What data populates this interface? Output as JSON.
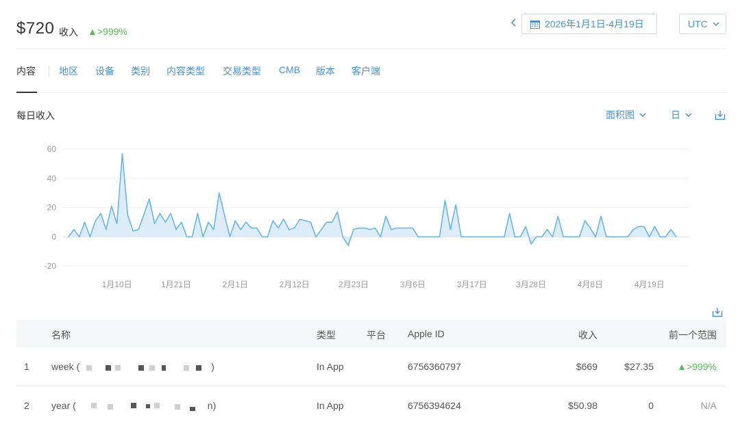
{
  "header": {
    "total": "$720",
    "total_label": "收入",
    "total_change": "▲>999%",
    "date_range": "2026年1月1日-4月19日",
    "timezone": "UTC"
  },
  "tabs": [
    "内容",
    "地区",
    "设备",
    "类别",
    "内容类型",
    "交易类型",
    "CMB",
    "版本",
    "客户端"
  ],
  "section": {
    "title": "每日收入",
    "chart_type_label": "面积图",
    "interval_label": "日"
  },
  "colors": {
    "accent": "#4a90d0",
    "area_fill": "#d6eaf8",
    "area_line": "#6ab4e6",
    "positive": "#5cb85c"
  },
  "icons": [
    "calendar-icon",
    "chevron-left-icon",
    "chevron-down-icon",
    "download-icon"
  ],
  "chart_data": {
    "type": "area",
    "title": "每日收入",
    "x_start": "2026-01-01",
    "y_ticks": [
      60,
      40,
      20,
      0,
      -20
    ],
    "x_ticks": [
      "1月10日",
      "1月21日",
      "2月1日",
      "2月12日",
      "2月23日",
      "3月6日",
      "3月17日",
      "3月28日",
      "4月8日",
      "4月19日"
    ],
    "ylim": [
      -20,
      60
    ],
    "grid": true,
    "series": [
      {
        "values": [
          0,
          5,
          0,
          10,
          0,
          11,
          16,
          5,
          21,
          9,
          57,
          15,
          4,
          5,
          15,
          26,
          9,
          16,
          10,
          16,
          5,
          10,
          0,
          0,
          16,
          0,
          10,
          5,
          30,
          15,
          0,
          11,
          5,
          10,
          6,
          6,
          0,
          0,
          11,
          6,
          12,
          5,
          6,
          12,
          11,
          10,
          0,
          5,
          10,
          10,
          17,
          0,
          -6,
          5,
          6,
          6,
          5,
          6,
          0,
          14,
          5,
          6,
          6,
          6,
          6,
          0,
          0,
          0,
          0,
          0,
          25,
          5,
          22,
          0,
          0,
          0,
          0,
          0,
          0,
          0,
          0,
          0,
          16,
          0,
          0,
          7,
          -5,
          0,
          0,
          5,
          0,
          14,
          0,
          0,
          0,
          0,
          11,
          6,
          0,
          14,
          0,
          0,
          0,
          0,
          0,
          5,
          7,
          7,
          0,
          7,
          0,
          0,
          5,
          0
        ]
      }
    ]
  },
  "table": {
    "columns": [
      "名称",
      "类型",
      "平台",
      "Apple ID",
      "收入",
      "前一个范围"
    ],
    "rows": [
      {
        "index": "1",
        "name": "week (",
        "name_end": ")",
        "type": "In App",
        "platform": "",
        "apple_id": "6756360797",
        "revenue": "$669",
        "previous": "$27.35",
        "change": "▲>999%"
      },
      {
        "index": "2",
        "name": "year (",
        "name_end": "n)",
        "type": "In App",
        "platform": "",
        "apple_id": "6756394624",
        "revenue": "$50.98",
        "previous": "0",
        "change": "N/A"
      }
    ]
  }
}
